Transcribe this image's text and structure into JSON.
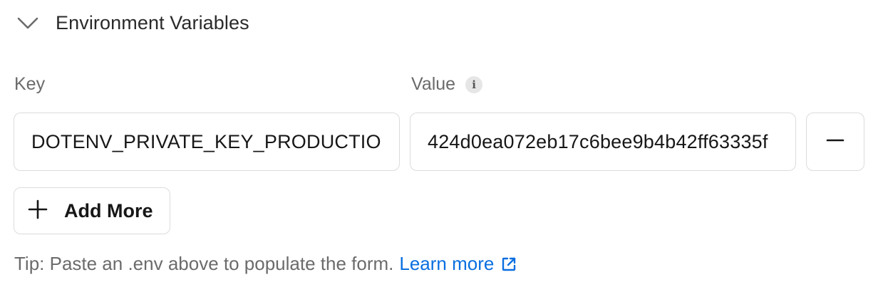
{
  "section": {
    "title": "Environment Variables",
    "toggle_icon": "chevron-down-icon"
  },
  "columns": {
    "key_label": "Key",
    "value_label": "Value",
    "value_info_icon": "info-icon"
  },
  "rows": [
    {
      "key": "DOTENV_PRIVATE_KEY_PRODUCTION",
      "value": "424d0ea072eb17c6bee9b4b42ff63335f"
    }
  ],
  "remove_button": {
    "icon": "minus-icon"
  },
  "add_more": {
    "label": "Add More",
    "icon": "plus-icon"
  },
  "tip": {
    "text": "Tip: Paste an .env above to populate the form.",
    "link_text": "Learn more",
    "link_icon": "external-link-icon"
  },
  "colors": {
    "link": "#0a6fe0",
    "muted_text": "#6b6b6b",
    "border": "#dcdcdc"
  }
}
